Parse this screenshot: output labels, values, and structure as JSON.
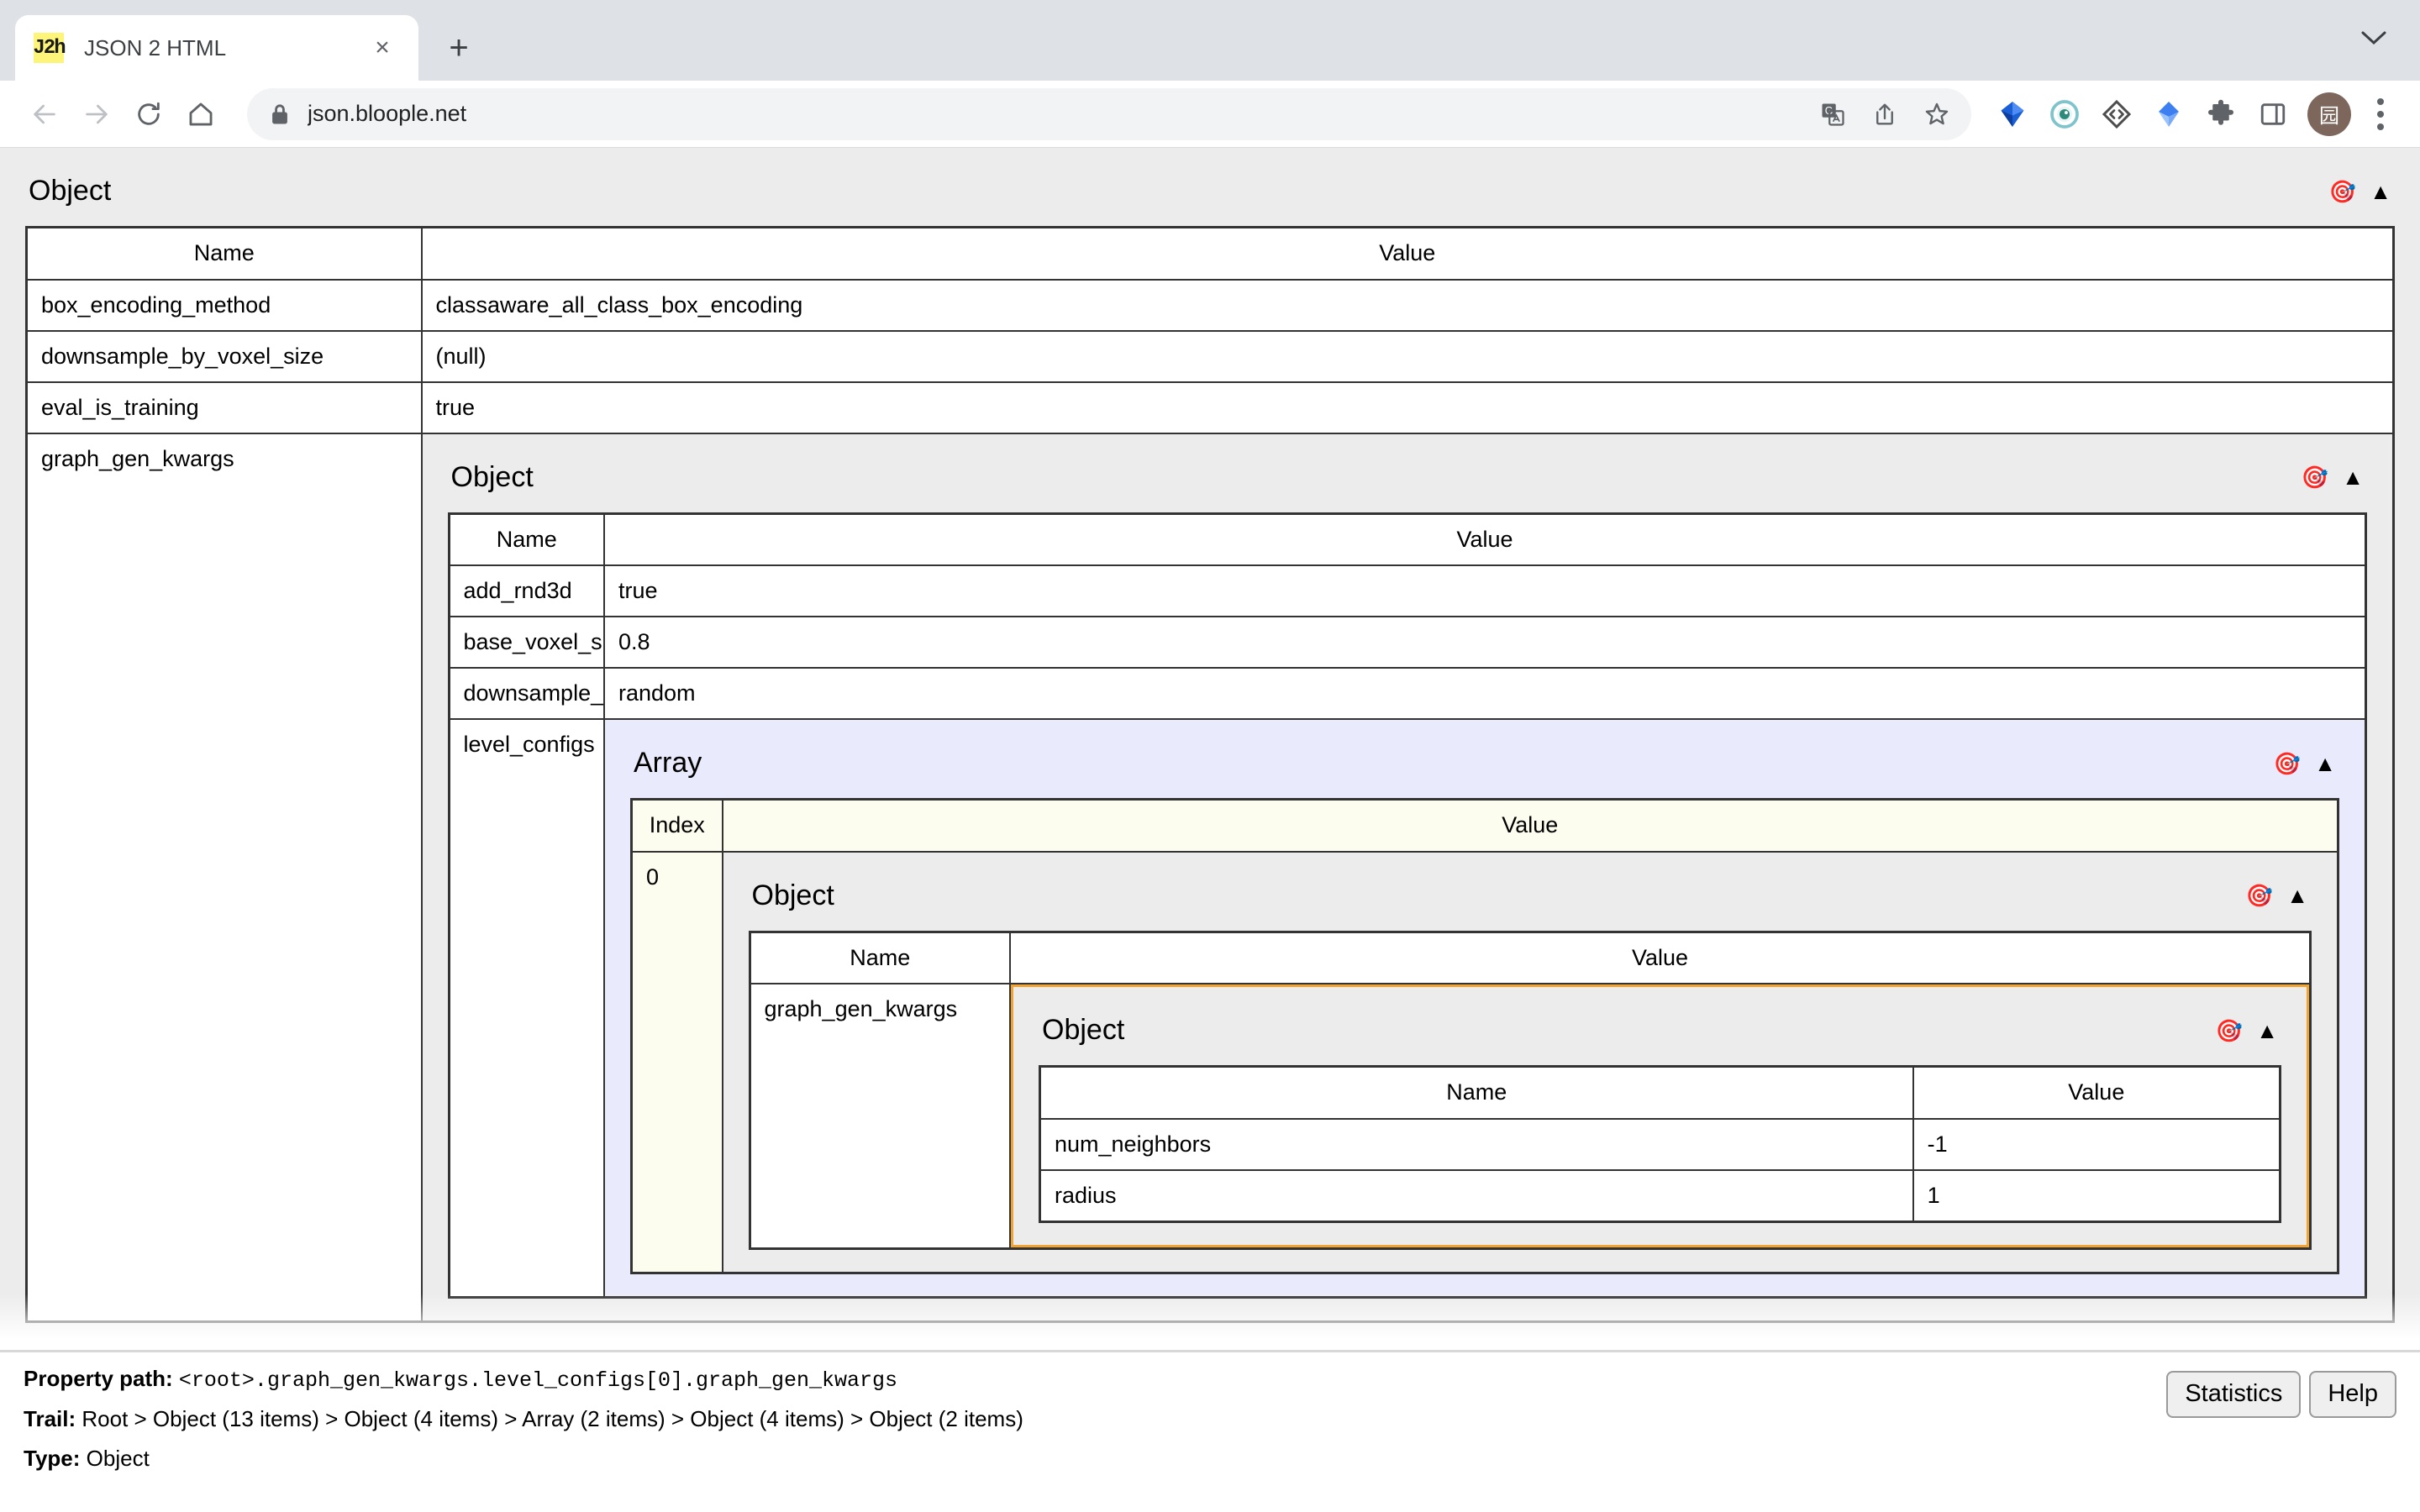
{
  "browser": {
    "tab": {
      "title": "JSON 2 HTML",
      "favicon_text": "J2h",
      "favicon_color": "#fdf47a",
      "close_glyph": "×"
    },
    "new_tab_glyph": "+",
    "tabstrip_menu_glyph": "⌄",
    "nav": {
      "back_glyph": "←",
      "forward_glyph": "→",
      "reload_glyph": "↻",
      "home_glyph": "⌂"
    },
    "omnibox": {
      "url": "json.bloople.net",
      "lock_icon": "lock-icon",
      "translate_icon": "translate-icon",
      "share_icon": "share-icon",
      "bookmark_icon": "bookmark-star-icon"
    },
    "extensions": [
      {
        "name": "vector-diamond-extension-icon",
        "color": "#1a5fd6"
      },
      {
        "name": "eye-target-extension-icon",
        "color": "#7fc4cd"
      },
      {
        "name": "code-diamond-extension-icon",
        "color": "#4d4d4d"
      },
      {
        "name": "blue-gem-extension-icon",
        "color": "#3d7ff0"
      },
      {
        "name": "puzzle-extensions-icon",
        "color": "#5f6368"
      },
      {
        "name": "side-panel-icon",
        "color": "#5f6368"
      }
    ],
    "avatar": {
      "glyph": "园",
      "color": "#7d665c"
    },
    "menu_icon": "three-dot-menu-icon"
  },
  "page": {
    "icons": {
      "target": "🎯",
      "collapse": "▲"
    },
    "labels": {
      "object": "Object",
      "array": "Array",
      "name": "Name",
      "value": "Value",
      "index": "Index"
    },
    "root": {
      "type": "Object",
      "rows": [
        {
          "name": "box_encoding_method",
          "value": "classaware_all_class_box_encoding",
          "kind": "string"
        },
        {
          "name": "downsample_by_voxel_size",
          "value": "(null)",
          "kind": "null"
        },
        {
          "name": "eval_is_training",
          "value": "true",
          "kind": "bool"
        },
        {
          "name": "graph_gen_kwargs",
          "value": "",
          "kind": "object"
        }
      ]
    },
    "level2": {
      "type": "Object",
      "rows": [
        {
          "name": "add_rnd3d",
          "value": "true",
          "kind": "bool"
        },
        {
          "name": "base_voxel_size",
          "value": "0.8",
          "kind": "number"
        },
        {
          "name": "downsample_method",
          "value": "random",
          "kind": "string"
        },
        {
          "name": "level_configs",
          "value": "",
          "kind": "array"
        }
      ]
    },
    "level3_array": {
      "type": "Array",
      "rows": [
        {
          "index": "0",
          "value": "",
          "kind": "object"
        }
      ]
    },
    "level4": {
      "type": "Object",
      "rows": [
        {
          "name": "graph_gen_kwargs",
          "value": "",
          "kind": "object"
        }
      ]
    },
    "level5": {
      "type": "Object",
      "selected": true,
      "rows": [
        {
          "name": "num_neighbors",
          "value": "-1",
          "kind": "number"
        },
        {
          "name": "radius",
          "value": "1",
          "kind": "number"
        }
      ]
    }
  },
  "statusbar": {
    "property_path_label": "Property path:",
    "property_path_value": "<root>.graph_gen_kwargs.level_configs[0].graph_gen_kwargs",
    "trail_label": "Trail:",
    "trail_value": "Root > Object (13 items) > Object (4 items) > Array (2 items) > Object (4 items) > Object (2 items)",
    "type_label": "Type:",
    "type_value": "Object",
    "statistics_button": "Statistics",
    "help_button": "Help"
  },
  "colors": {
    "object_panel_bg": "#ececec",
    "array_panel_bg": "#e9eafb",
    "array_table_bg": "#fdfdef",
    "selected_border": "#f0a330",
    "number": "#0000ee",
    "bool": "#e8730a",
    "null": "#0000ee",
    "border": "#333333"
  }
}
